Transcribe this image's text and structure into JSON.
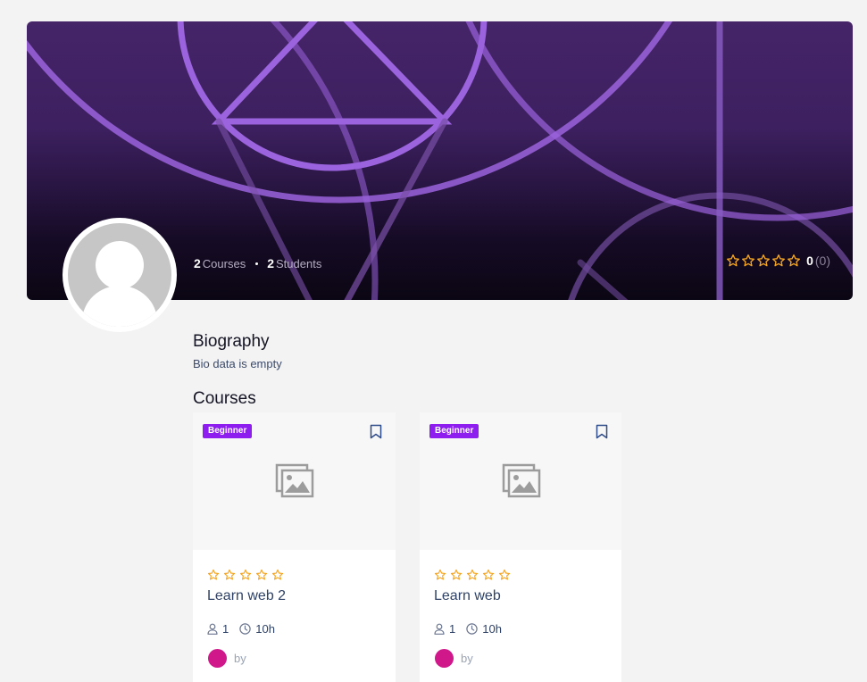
{
  "profile": {
    "courses_count": "2",
    "courses_label": "Courses",
    "students_count": "2",
    "students_label": "Students",
    "rating_value": "0",
    "rating_count": "(0)",
    "rating_stars": 5
  },
  "biography": {
    "title": "Biography",
    "text": "Bio data is empty"
  },
  "courses": {
    "title": "Courses",
    "items": [
      {
        "level": "Beginner",
        "title": "Learn web 2",
        "students": "1",
        "duration": "10h",
        "author_label": "by",
        "rating": 0
      },
      {
        "level": "Beginner",
        "title": "Learn web",
        "students": "1",
        "duration": "10h",
        "author_label": "by",
        "rating": 0
      }
    ]
  },
  "colors": {
    "accent": "#8e1df0",
    "star": "#f5a623",
    "avatar_author": "#d0188b"
  }
}
